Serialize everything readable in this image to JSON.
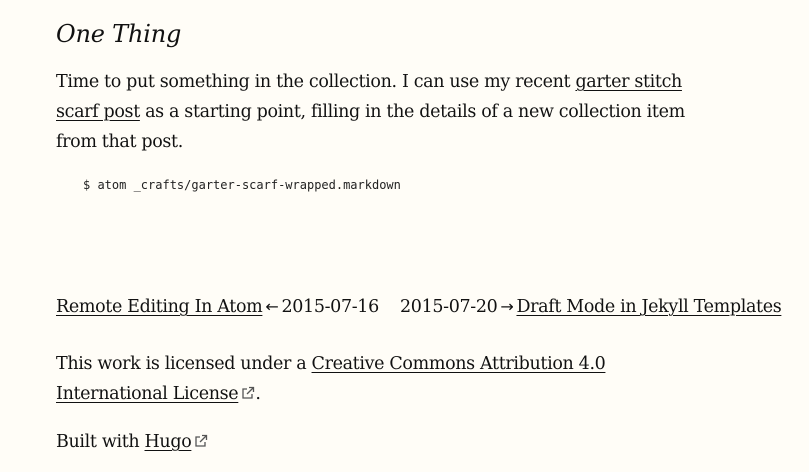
{
  "post": {
    "heading": "One Thing",
    "intro_before": "Time to put something in the collection. I can use my recent ",
    "intro_link": "garter stitch scarf post",
    "intro_after": " as a starting point, filling in the details of a new collection item from that post.",
    "code": "$ atom _crafts/garter-scarf-wrapped.markdown"
  },
  "nav": {
    "prev_title": "Remote Editing In Atom",
    "prev_arrow": "←",
    "prev_date": "2015-07-16",
    "next_date": "2015-07-20",
    "next_arrow": "→",
    "next_title": "Draft Mode in Jekyll Templates"
  },
  "footer": {
    "license_before": "This work is licensed under a ",
    "license_link": "Creative Commons Attribution 4.0 International License",
    "license_after": ".",
    "built_before": "Built with ",
    "built_link": "Hugo",
    "external_icon": "external-link-icon"
  }
}
